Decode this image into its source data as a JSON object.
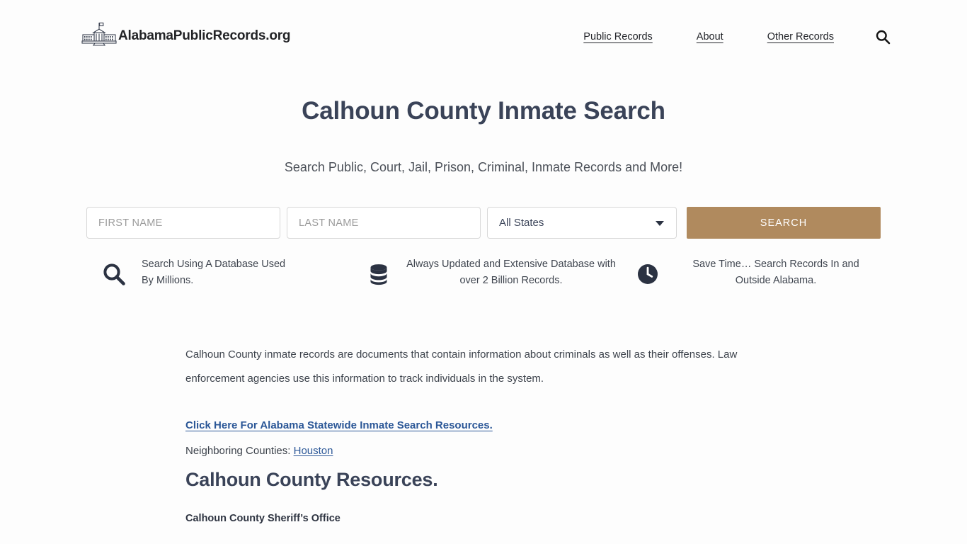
{
  "header": {
    "logo_icon": "white-house-icon",
    "brand_text": "AlabamaPublicRecords.org",
    "nav": [
      {
        "label": "Public Records"
      },
      {
        "label": "About"
      },
      {
        "label": "Other Records"
      }
    ],
    "search_icon": "search-icon"
  },
  "hero": {
    "title": "Calhoun County Inmate Search",
    "subtitle": "Search Public, Court, Jail, Prison, Criminal, Inmate Records and More!"
  },
  "search_form": {
    "first_name_value": "",
    "first_name_placeholder": "FIRST NAME",
    "last_name_value": "",
    "last_name_placeholder": "LAST NAME",
    "state_selected": "All States",
    "state_options": [
      "All States"
    ],
    "submit_label": "SEARCH",
    "submit_color": "#b08a5e"
  },
  "features": [
    {
      "icon": "search-icon",
      "text": "Search Using A Database Used By Millions."
    },
    {
      "icon": "database-icon",
      "text": "Always Updated and Extensive Database with over 2 Billion Records."
    },
    {
      "icon": "clock-icon",
      "text": "Save Time… Search Records In and Outside Alabama."
    }
  ],
  "article": {
    "paragraph": "Calhoun County inmate records are documents that contain information about criminals as well as their offenses. Law enforcement agencies use this information to track individuals in the system.",
    "statewide_link": "Click Here For Alabama Statewide Inmate Search Resources.",
    "neighbors_label": "Neighboring Counties:",
    "neighbors": [
      {
        "label": "Houston"
      }
    ],
    "resources_heading": "Calhoun County Resources.",
    "resource_item": "Calhoun County Sheriff’s Office"
  },
  "theme": {
    "background": "#fdfdfd",
    "heading_color": "#3a4358",
    "link_color": "#2b5797",
    "accent": "#b08a5e"
  }
}
